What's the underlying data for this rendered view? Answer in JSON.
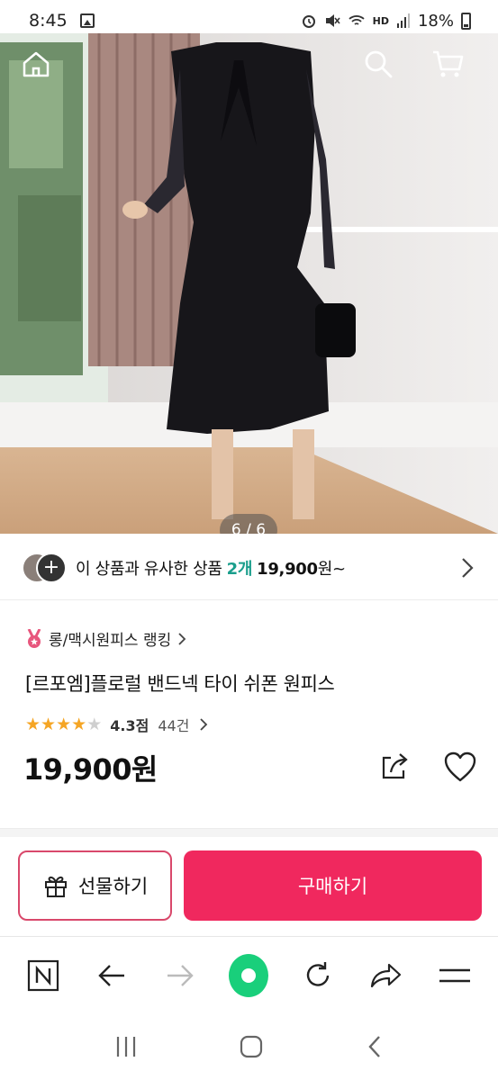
{
  "status": {
    "time": "8:45",
    "battery": "18%",
    "network": "HD"
  },
  "hero": {
    "page_indicator": "6 / 6",
    "icons": [
      "home-icon",
      "search-icon",
      "cart-icon"
    ]
  },
  "similar": {
    "prefix": "이 상품과 유사한 상품",
    "count": "2개",
    "price": "19,900",
    "suffix": "원~"
  },
  "product": {
    "ranking": "롱/맥시원피스 랭킹",
    "title": "[르포엠]플로럴 밴드넥 타이 쉬폰 원피스",
    "rating_value": 4.3,
    "rating_max": 5,
    "rating_label": "4.3점",
    "reviews": "44건",
    "price": "19,900원"
  },
  "actions": {
    "gift": "선물하기",
    "buy": "구매하기"
  },
  "colors": {
    "accent": "#f0285e",
    "teal": "#1a9e8c",
    "star": "#f5a524",
    "green": "#19cf7b"
  }
}
